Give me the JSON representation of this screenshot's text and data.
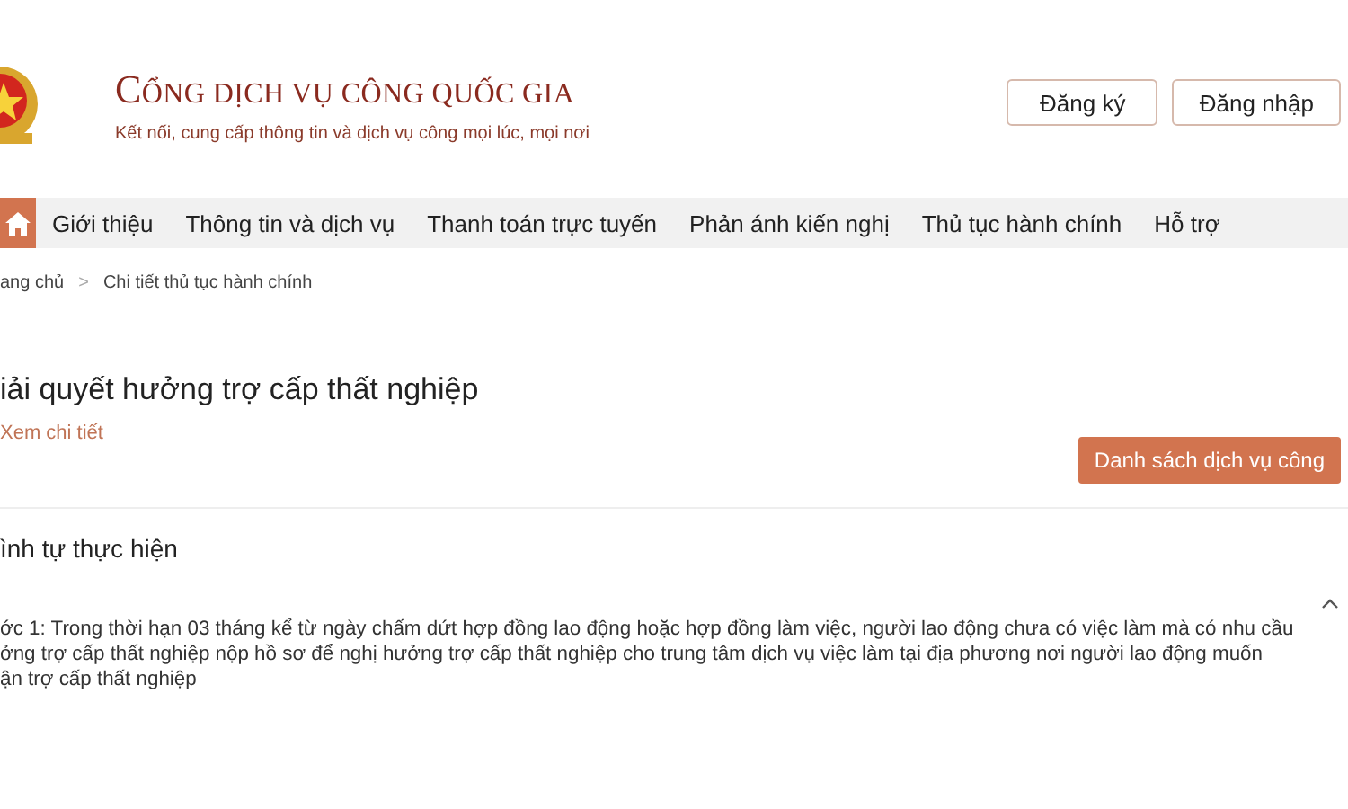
{
  "header": {
    "title": "CỔNG DỊCH VỤ CÔNG QUỐC GIA",
    "tagline": "Kết nối, cung cấp thông tin và dịch vụ công mọi lúc, mọi nơi",
    "buttons": [
      "Đăng ký",
      "Đăng nhập"
    ]
  },
  "nav": {
    "items": [
      "Giới thiệu",
      "Thông tin và dịch vụ",
      "Thanh toán trực tuyến",
      "Phản ánh kiến nghị",
      "Thủ tục hành chính",
      "Hỗ trợ"
    ]
  },
  "breadcrumb": [
    "ang chủ",
    "Chi tiết thủ tục hành chính"
  ],
  "breadcrumb_separator": ">",
  "page": {
    "title": "iải quyết hưởng trợ cấp thất nghiệp",
    "detail_link": "Xem chi tiết",
    "list_button": "Danh sách dịch vụ công"
  },
  "section": {
    "heading": "ình tự thực hiện",
    "expanded": true,
    "lines": [
      "ớc 1: Trong thời hạn 03 tháng kể từ ngày chấm dứt hợp đồng lao động hoặc hợp đồng làm việc, người lao động chưa có việc làm mà có nhu cầu",
      "ởng trợ cấp thất nghiệp nộp hồ sơ để nghị hưởng trợ cấp thất nghiệp cho trung tâm dịch vụ việc làm tại địa phương nơi người lao động muốn",
      "ận trợ cấp thất nghiệp"
    ]
  }
}
